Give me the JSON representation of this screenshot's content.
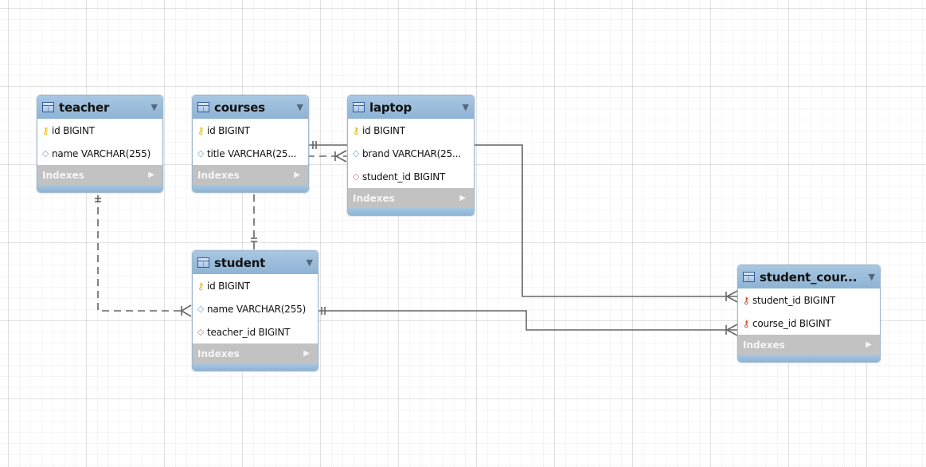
{
  "entities": {
    "teacher": {
      "title": "teacher",
      "columns": [
        {
          "icon": "primary-key-icon",
          "text": "id BIGINT"
        },
        {
          "icon": "not-null-column-icon",
          "text": "name VARCHAR(255)"
        }
      ],
      "indexes": "Indexes"
    },
    "courses": {
      "title": "courses",
      "columns": [
        {
          "icon": "primary-key-icon",
          "text": "id BIGINT"
        },
        {
          "icon": "not-null-column-icon",
          "text": "title VARCHAR(25..."
        }
      ],
      "indexes": "Indexes"
    },
    "laptop": {
      "title": "laptop",
      "columns": [
        {
          "icon": "primary-key-icon",
          "text": "id BIGINT"
        },
        {
          "icon": "not-null-column-icon",
          "text": "brand VARCHAR(25..."
        },
        {
          "icon": "foreign-key-column-icon",
          "text": "student_id BIGINT"
        }
      ],
      "indexes": "Indexes"
    },
    "student": {
      "title": "student",
      "columns": [
        {
          "icon": "primary-key-icon",
          "text": "id BIGINT"
        },
        {
          "icon": "not-null-column-icon",
          "text": "name VARCHAR(255)"
        },
        {
          "icon": "foreign-key-column-icon",
          "text": "teacher_id BIGINT"
        }
      ],
      "indexes": "Indexes"
    },
    "student_course": {
      "title": "student_cour...",
      "columns": [
        {
          "icon": "primary-foreign-key-icon",
          "text": "student_id BIGINT"
        },
        {
          "icon": "primary-foreign-key-icon",
          "text": "course_id BIGINT"
        }
      ],
      "indexes": "Indexes"
    }
  },
  "relationships": [
    {
      "from": "teacher",
      "to": "student",
      "style": "dashed",
      "from_end": "one",
      "to_end": "many"
    },
    {
      "from": "courses",
      "to": "student",
      "style": "dashed",
      "from_end": "one",
      "to_end": "one"
    },
    {
      "from": "courses",
      "to": "laptop",
      "style": "mixed",
      "from_end": "one",
      "to_end": "many"
    },
    {
      "from": "laptop",
      "to": "student_course",
      "style": "solid",
      "from_end": "none",
      "to_end": "many"
    },
    {
      "from": "student",
      "to": "student_course",
      "style": "solid",
      "from_end": "one",
      "to_end": "many"
    }
  ],
  "colors": {
    "header": "#99bddc",
    "line": "#666666",
    "indexes_bar": "#c2c2c2"
  }
}
